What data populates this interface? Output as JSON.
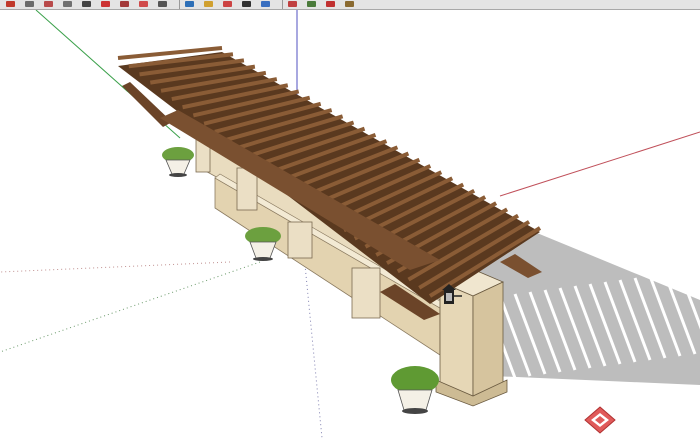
{
  "toolbar": {
    "buttons": [
      {
        "icon": "eraser-icon",
        "color": "#c0392b"
      },
      {
        "icon": "pencil-icon",
        "color": "#6b6b6b"
      },
      {
        "icon": "shape-icon",
        "color": "#b84a4a"
      },
      {
        "icon": "paint-icon",
        "color": "#707070"
      },
      {
        "icon": "select-icon",
        "color": "#444444"
      },
      {
        "icon": "rotate-icon",
        "color": "#cc3333"
      },
      {
        "icon": "pushpull-icon",
        "color": "#a33a3a"
      },
      {
        "icon": "offset-icon",
        "color": "#d04a4a"
      },
      {
        "icon": "tape-icon",
        "color": "#555555"
      },
      {
        "icon": "dimension-icon",
        "color": "#2d6fb7"
      },
      {
        "icon": "text-icon",
        "color": "#d0a030"
      },
      {
        "icon": "orbit-icon",
        "color": "#cc4444"
      },
      {
        "icon": "pan-icon",
        "color": "#303030"
      },
      {
        "icon": "zoom-icon",
        "color": "#3a6fc0"
      },
      {
        "icon": "zoom-extents-icon",
        "color": "#c04040"
      },
      {
        "icon": "layers-icon",
        "color": "#4a7a3a"
      },
      {
        "icon": "components-icon",
        "color": "#c03030"
      },
      {
        "icon": "section-icon",
        "color": "#8a6a30"
      }
    ]
  },
  "viewport": {
    "background": "#ffffff",
    "axes": {
      "red": "#c0505a",
      "green": "#3aa04a",
      "blue": "#5050c0"
    },
    "model": {
      "wood": "#6b4428",
      "stone": "#e9dcbf",
      "shadow": "#bdbdbd"
    },
    "watermark_icon": "watermark-logo-icon"
  }
}
